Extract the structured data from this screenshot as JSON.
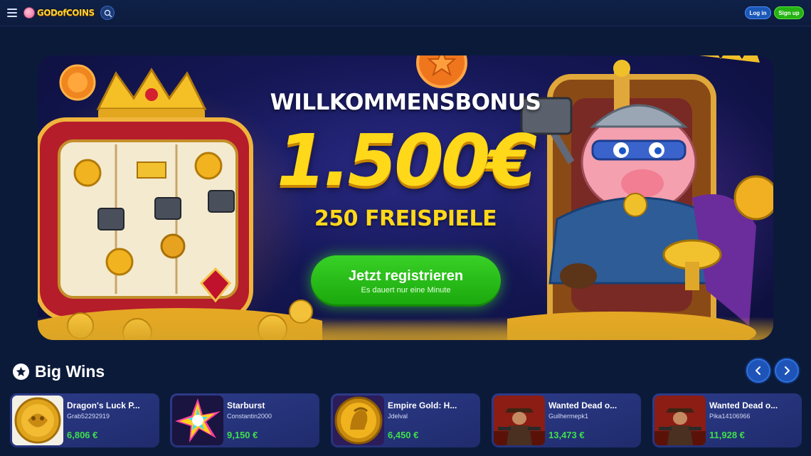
{
  "header": {
    "logo_text": "GODofCOINS",
    "login_label": "Log in",
    "signup_label": "Sign up"
  },
  "hero": {
    "heading": "WILLKOMMENSBONUS",
    "amount": "1.500€",
    "spins": "250 FREISPIELE",
    "cta_title": "Jetzt registrieren",
    "cta_subtitle": "Es dauert nur eine Minute"
  },
  "big_wins": {
    "title": "Big Wins",
    "items": [
      {
        "game": "Dragon's Luck P...",
        "user": "Grab52292919",
        "amount": "6,806 €",
        "thumb": "golden-dragon-coin"
      },
      {
        "game": "Starburst",
        "user": "Constantin2000",
        "amount": "9,150 €",
        "thumb": "rainbow-star"
      },
      {
        "game": "Empire Gold: H...",
        "user": "Jdelval",
        "amount": "6,450 €",
        "thumb": "gold-emperor-coin"
      },
      {
        "game": "Wanted Dead o...",
        "user": "Guilhermepk1",
        "amount": "13,473 €",
        "thumb": "cowboy-gunslinger"
      },
      {
        "game": "Wanted Dead o...",
        "user": "Pika14106966",
        "amount": "11,928 €",
        "thumb": "cowboy-gunslinger"
      }
    ]
  },
  "colors": {
    "background": "#0c1a3a",
    "accent_yellow": "#ffd81a",
    "cta_green": "#24b312",
    "win_amount_green": "#3fe04b"
  }
}
